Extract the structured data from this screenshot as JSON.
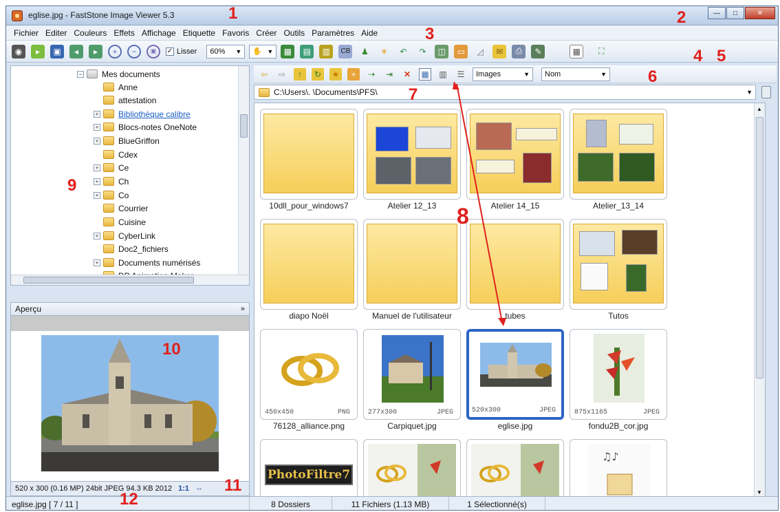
{
  "window": {
    "title": "eglise.jpg - FastStone Image Viewer 5.3",
    "controls": {
      "minimize": "—",
      "maximize": "□",
      "close": "✕"
    }
  },
  "menu": [
    "Fichier",
    "Editer",
    "Couleurs",
    "Effets",
    "Affichage",
    "Etiquette",
    "Favoris",
    "Créer",
    "Outils",
    "Paramètres",
    "Aide"
  ],
  "toolbar": {
    "zoom_value": "60%",
    "smooth_label": "Lisser",
    "smooth_checked": "✓",
    "hand_label": "✋",
    "accent_color": "#2d64c4"
  },
  "nav": {
    "filter_value": "Images",
    "sort_value": "Nom",
    "path": "C:\\Users\\.     \\Documents\\PFS\\"
  },
  "tree": {
    "root_label": "Mes documents",
    "items": [
      {
        "label": "Anne",
        "expand": ""
      },
      {
        "label": "attestation",
        "expand": ""
      },
      {
        "label": "Bibliothèque calibre",
        "expand": "+",
        "link": true
      },
      {
        "label": "Blocs-notes OneNote",
        "expand": "+"
      },
      {
        "label": "BlueGriffon",
        "expand": "+"
      },
      {
        "label": "Cdex",
        "expand": ""
      },
      {
        "label": "Ce",
        "expand": "+"
      },
      {
        "label": "Ch",
        "expand": "+"
      },
      {
        "label": "Co",
        "expand": "+"
      },
      {
        "label": "Courrier",
        "expand": ""
      },
      {
        "label": "Cuisine",
        "expand": ""
      },
      {
        "label": "CyberLink",
        "expand": "+"
      },
      {
        "label": "Doc2_fichiers",
        "expand": ""
      },
      {
        "label": "Documents numérisés",
        "expand": "+"
      },
      {
        "label": "DP Animation Maker",
        "expand": ""
      }
    ]
  },
  "preview": {
    "header": "Aperçu",
    "info": "520 x 300 (0.16 MP)  24bit  JPEG   94.3 KB   2012",
    "ratio": "1:1"
  },
  "thumbnails": [
    {
      "name": "10dll_pour_windows7",
      "kind": "folder"
    },
    {
      "name": "Atelier 12_13",
      "kind": "folder"
    },
    {
      "name": "Atelier 14_15",
      "kind": "folder"
    },
    {
      "name": "Atelier_13_14",
      "kind": "folder"
    },
    {
      "name": "diapo Noël",
      "kind": "folder"
    },
    {
      "name": "Manuel de l'utilisateur",
      "kind": "folder"
    },
    {
      "name": "tubes",
      "kind": "folder"
    },
    {
      "name": "Tutos",
      "kind": "folder"
    },
    {
      "name": "76128_alliance.png",
      "kind": "image",
      "dims": "450x450",
      "format": "PNG"
    },
    {
      "name": "Carpiquet.jpg",
      "kind": "image",
      "dims": "277x300",
      "format": "JPEG"
    },
    {
      "name": "eglise.jpg",
      "kind": "image",
      "dims": "520x300",
      "format": "JPEG",
      "selected": true
    },
    {
      "name": "fondu2B_cor.jpg",
      "kind": "image",
      "dims": "875x1165",
      "format": "JPEG"
    },
    {
      "name": "PhotoFiltre7",
      "kind": "image"
    },
    {
      "name": "",
      "kind": "image"
    },
    {
      "name": "",
      "kind": "image"
    },
    {
      "name": "",
      "kind": "image"
    }
  ],
  "status": {
    "file": "eglise.jpg [ 7 / 11 ]",
    "folders": "8 Dossiers",
    "files": "11 Fichiers (1.13 MB)",
    "selected": "1 Sélectionné(s)"
  },
  "annotations": [
    "1",
    "2",
    "3",
    "4",
    "5",
    "6",
    "7",
    "8",
    "9",
    "10",
    "11",
    "12"
  ]
}
